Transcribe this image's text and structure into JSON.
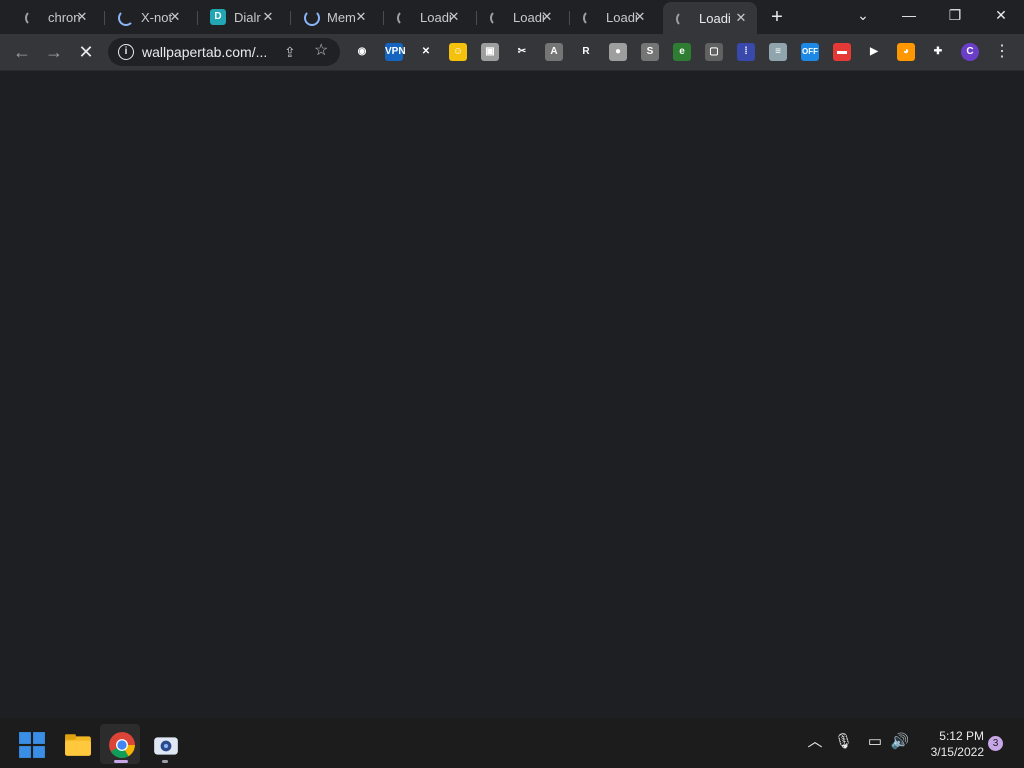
{
  "tabs": [
    {
      "title": "chron",
      "state": "loading"
    },
    {
      "title": "X-not",
      "state": "loading-blue"
    },
    {
      "title": "Dialr",
      "state": "favicon",
      "favicon_text": "D"
    },
    {
      "title": "Mem",
      "state": "loading-blue2"
    },
    {
      "title": "Loadi",
      "state": "loading"
    },
    {
      "title": "Loadi",
      "state": "loading"
    },
    {
      "title": "Loadi",
      "state": "loading"
    },
    {
      "title": "Loadi",
      "state": "loading",
      "active": true
    }
  ],
  "toolbar": {
    "url": "wallpapertab.com/...",
    "extensions": [
      {
        "name": "rss-icon",
        "label": "◉",
        "color": "#35363a"
      },
      {
        "name": "vpn-icon",
        "label": "VPN",
        "color": "#1565c0"
      },
      {
        "name": "tools-icon",
        "label": "✕",
        "color": "#35363a"
      },
      {
        "name": "smiley-icon",
        "label": "☺",
        "color": "#f4c20d"
      },
      {
        "name": "image-icon",
        "label": "▣",
        "color": "#9e9e9e"
      },
      {
        "name": "scissors-icon",
        "label": "✂",
        "color": "#35363a"
      },
      {
        "name": "font-icon",
        "label": "A",
        "color": "#757575"
      },
      {
        "name": "r-icon",
        "label": "R",
        "color": "#35363a"
      },
      {
        "name": "chat-icon",
        "label": "●",
        "color": "#9e9e9e"
      },
      {
        "name": "s-icon",
        "label": "S",
        "color": "#757575"
      },
      {
        "name": "edge-icon",
        "label": "e",
        "color": "#2e7d32"
      },
      {
        "name": "puzzle-icon",
        "label": "▢",
        "color": "#616161"
      },
      {
        "name": "grid-icon",
        "label": "⁞",
        "color": "#3949ab"
      },
      {
        "name": "flag-icon",
        "label": "≡",
        "color": "#90a4ae"
      },
      {
        "name": "off-icon",
        "label": "OFF",
        "color": "#1e88e5"
      },
      {
        "name": "card-icon",
        "label": "▬",
        "color": "#e53935"
      },
      {
        "name": "play-icon",
        "label": "▶",
        "color": "#35363a"
      },
      {
        "name": "monkey-icon",
        "label": "◕",
        "color": "#ff9800"
      },
      {
        "name": "extensions-icon",
        "label": "✚",
        "color": "#35363a"
      },
      {
        "name": "profile-avatar",
        "label": "C",
        "color": "#6a3ec8"
      }
    ]
  },
  "taskbar": {
    "time": "5:12 PM",
    "date": "3/15/2022",
    "notifications": "3"
  }
}
